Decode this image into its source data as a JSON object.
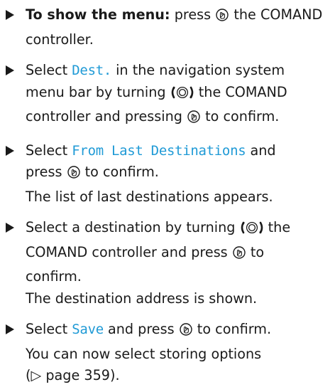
{
  "steps": [
    {
      "bold_label": "To show the menu:",
      "t1": " press ",
      "t2": " the COMAND",
      "t3": "controller."
    },
    {
      "t1": "Select ",
      "menu_term": "Dest.",
      "t2": " in the navigation system",
      "t3": "menu bar by turning ",
      "t4": " the COMAND",
      "t5": "controller and pressing ",
      "t6": " to confirm."
    },
    {
      "t1": "Select ",
      "menu_term": "From Last Destinations",
      "t2": " and",
      "t3": "press ",
      "t4": " to confirm.",
      "result": "The list of last destinations appears."
    },
    {
      "t1": "Select a destination by turning ",
      "t2": " the",
      "t3": "COMAND controller and press ",
      "t4": " to",
      "t5": "confirm.",
      "result": "The destination address is shown."
    },
    {
      "t1": "Select ",
      "menu_term": "Save",
      "t2": " and press ",
      "t3": " to confirm.",
      "result1": "You can now select storing options",
      "result2": "(▷ page 359)."
    }
  ],
  "icons": {
    "press": "press-controller-icon",
    "turn": "turn-controller-icon"
  }
}
